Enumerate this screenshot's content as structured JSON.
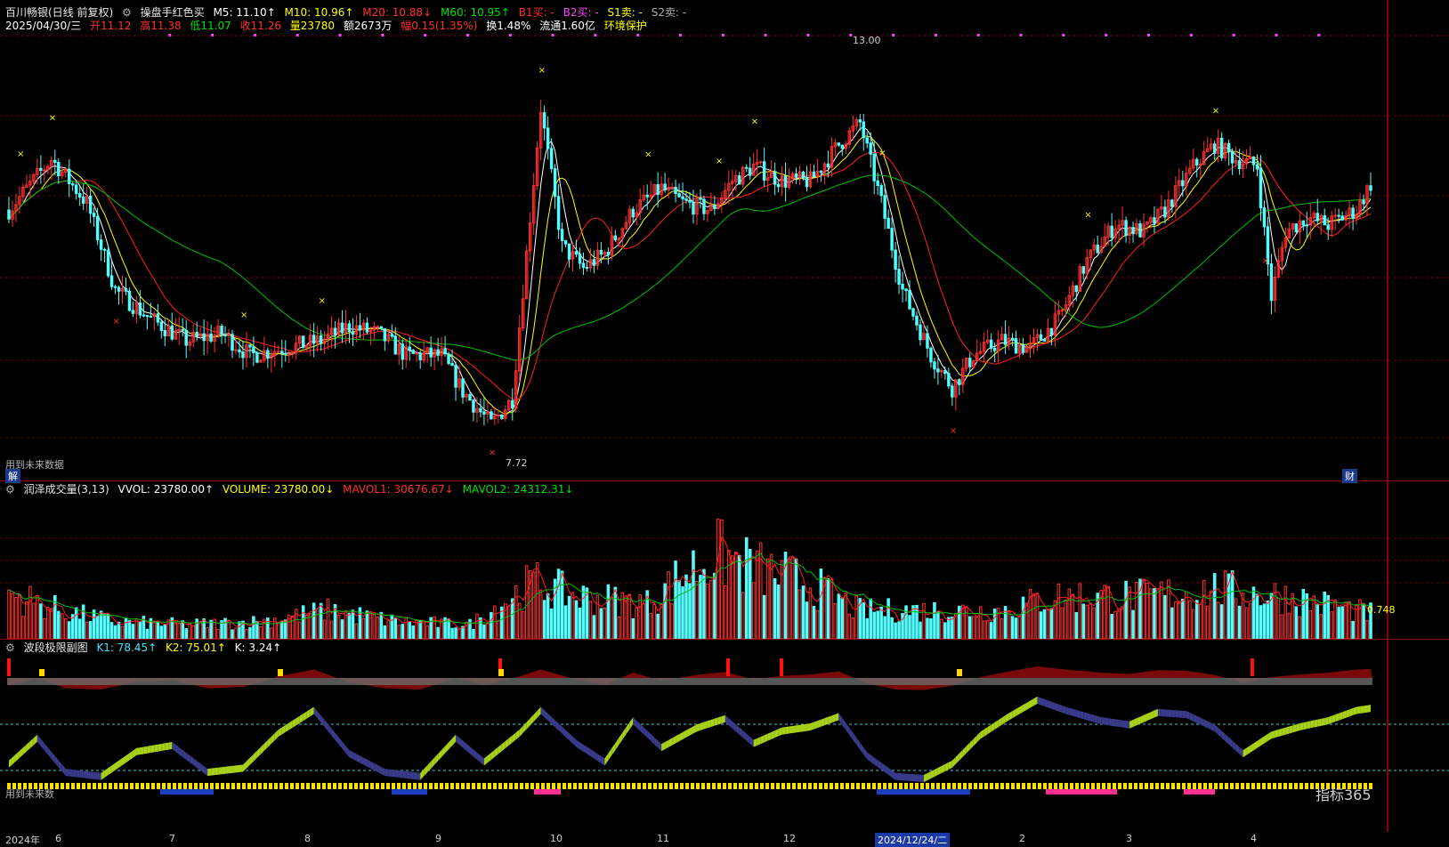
{
  "header": {
    "title": "百川畅银(日线 前复权)",
    "indicator": "操盘手红色买",
    "m5": "M5: 11.10↑",
    "m10": "M10: 10.96↑",
    "m20": "M20: 10.88↓",
    "m60": "M60: 10.95↑",
    "b1": "B1买: -",
    "b2": "B2买: -",
    "s1": "S1卖: -",
    "s2": "S2卖: -"
  },
  "quote": {
    "date": "2025/04/30/三",
    "open": "开11.12",
    "high": "高11.38",
    "low": "低11.07",
    "close": "收11.26",
    "vol": "量23780",
    "amount": "额2673万",
    "change": "幅0.15(1.35%)",
    "turnover": "换1.48%",
    "float": "流通1.60亿",
    "env": "环境保护"
  },
  "notes": {
    "future_data_main": "用到未来数据",
    "future_data_sub": "用到未来数",
    "jie": "解",
    "cai": "财",
    "high_mark": "13.00",
    "low_mark": "7.72",
    "vol_mark": "0.748",
    "logo": "指标365"
  },
  "volume_panel": {
    "name": "润泽成交量(3,13)",
    "vvol": "VVOL: 23780.00↑",
    "volume": "VOLUME: 23780.00↓",
    "mavol1": "MAVOL1: 30676.67↓",
    "mavol2": "MAVOL2: 24312.31↓"
  },
  "wave_panel": {
    "name": "波段极限副图",
    "k1": "K1: 78.45↑",
    "k2": "K2: 75.01↑",
    "k": "K: 3.24↑"
  },
  "x_axis": {
    "year": "2024年",
    "months": [
      "6",
      "7",
      "8",
      "9",
      "10",
      "11",
      "12",
      "2",
      "3",
      "4"
    ],
    "highlight": "2024/12/24/二"
  },
  "colors": {
    "up": "#ff3030",
    "down": "#54fcfc",
    "ma5": "#ffffff",
    "ma10": "#ffff00",
    "ma20": "#ff2020",
    "ma60": "#00c000"
  },
  "chart_data": {
    "type": "candlestick",
    "title": "百川畅银(日线 前复权)",
    "marked_high": 13.0,
    "marked_low": 7.72,
    "price_path": [
      [
        0,
        10.9
      ],
      [
        12,
        11.6
      ],
      [
        22,
        11.0
      ],
      [
        30,
        9.8
      ],
      [
        40,
        9.4
      ],
      [
        50,
        9.1
      ],
      [
        60,
        9.2
      ],
      [
        68,
        8.9
      ],
      [
        78,
        9.0
      ],
      [
        88,
        9.1
      ],
      [
        96,
        9.3
      ],
      [
        104,
        9.2
      ],
      [
        112,
        8.9
      ],
      [
        122,
        8.9
      ],
      [
        128,
        8.4
      ],
      [
        136,
        7.95
      ],
      [
        142,
        8.3
      ],
      [
        150,
        12.3
      ],
      [
        156,
        10.4
      ],
      [
        162,
        10.1
      ],
      [
        168,
        10.3
      ],
      [
        176,
        10.9
      ],
      [
        184,
        11.2
      ],
      [
        190,
        11.0
      ],
      [
        198,
        10.9
      ],
      [
        204,
        11.3
      ],
      [
        210,
        11.5
      ],
      [
        218,
        11.3
      ],
      [
        226,
        11.3
      ],
      [
        234,
        11.8
      ],
      [
        240,
        12.1
      ],
      [
        246,
        11.0
      ],
      [
        252,
        9.8
      ],
      [
        260,
        8.9
      ],
      [
        266,
        8.45
      ],
      [
        272,
        8.9
      ],
      [
        280,
        9.1
      ],
      [
        288,
        9.0
      ],
      [
        296,
        9.4
      ],
      [
        304,
        10.2
      ],
      [
        312,
        10.7
      ],
      [
        320,
        10.6
      ],
      [
        326,
        10.9
      ],
      [
        334,
        11.5
      ],
      [
        340,
        11.8
      ],
      [
        346,
        11.6
      ],
      [
        352,
        11.5
      ],
      [
        356,
        9.7
      ],
      [
        360,
        10.6
      ],
      [
        366,
        10.8
      ],
      [
        372,
        10.7
      ],
      [
        380,
        10.9
      ],
      [
        384,
        11.26
      ]
    ],
    "volume_path": [
      [
        0,
        0.32
      ],
      [
        15,
        0.2
      ],
      [
        30,
        0.12
      ],
      [
        50,
        0.1
      ],
      [
        70,
        0.12
      ],
      [
        90,
        0.2
      ],
      [
        110,
        0.12
      ],
      [
        130,
        0.1
      ],
      [
        148,
        0.4
      ],
      [
        160,
        0.3
      ],
      [
        180,
        0.25
      ],
      [
        190,
        0.45
      ],
      [
        200,
        0.6
      ],
      [
        210,
        0.5
      ],
      [
        225,
        0.4
      ],
      [
        240,
        0.2
      ],
      [
        260,
        0.2
      ],
      [
        280,
        0.2
      ],
      [
        295,
        0.3
      ],
      [
        320,
        0.3
      ],
      [
        340,
        0.35
      ],
      [
        360,
        0.3
      ],
      [
        384,
        0.18
      ]
    ],
    "osc_path": [
      [
        0,
        20
      ],
      [
        8,
        45
      ],
      [
        16,
        12
      ],
      [
        26,
        8
      ],
      [
        36,
        32
      ],
      [
        46,
        38
      ],
      [
        56,
        12
      ],
      [
        66,
        16
      ],
      [
        76,
        50
      ],
      [
        86,
        72
      ],
      [
        96,
        30
      ],
      [
        106,
        12
      ],
      [
        116,
        8
      ],
      [
        126,
        45
      ],
      [
        134,
        22
      ],
      [
        144,
        50
      ],
      [
        150,
        72
      ],
      [
        160,
        40
      ],
      [
        168,
        22
      ],
      [
        176,
        62
      ],
      [
        184,
        36
      ],
      [
        194,
        55
      ],
      [
        202,
        64
      ],
      [
        210,
        40
      ],
      [
        218,
        52
      ],
      [
        226,
        56
      ],
      [
        234,
        66
      ],
      [
        242,
        28
      ],
      [
        250,
        8
      ],
      [
        258,
        6
      ],
      [
        266,
        20
      ],
      [
        274,
        48
      ],
      [
        282,
        66
      ],
      [
        290,
        82
      ],
      [
        298,
        72
      ],
      [
        308,
        62
      ],
      [
        316,
        58
      ],
      [
        324,
        70
      ],
      [
        332,
        68
      ],
      [
        340,
        55
      ],
      [
        348,
        30
      ],
      [
        356,
        48
      ],
      [
        364,
        56
      ],
      [
        372,
        62
      ],
      [
        380,
        72
      ],
      [
        384,
        74
      ]
    ],
    "ylim": [
      7.3,
      13.3
    ]
  }
}
